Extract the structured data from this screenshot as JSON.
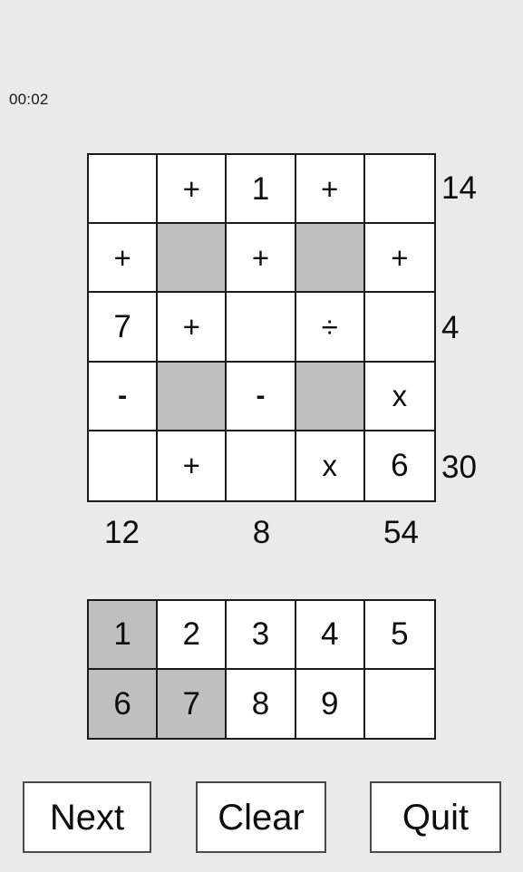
{
  "timer": {
    "label": "00:02"
  },
  "colors": {
    "background": "#eaeaea",
    "cell_background": "#ffffff",
    "blocked_cell": "#bfbfbf",
    "grid_line": "#1a1a1a",
    "text": "#0d0d0d",
    "button_border": "#4a4a4a"
  },
  "puzzle": {
    "rows": [
      [
        {
          "text": "",
          "blocked": false,
          "kind": "number-slot"
        },
        {
          "text": "+",
          "blocked": false,
          "kind": "operator"
        },
        {
          "text": "1",
          "blocked": false,
          "kind": "number"
        },
        {
          "text": "+",
          "blocked": false,
          "kind": "operator"
        },
        {
          "text": "",
          "blocked": false,
          "kind": "number-slot"
        }
      ],
      [
        {
          "text": "+",
          "blocked": false,
          "kind": "operator"
        },
        {
          "text": "",
          "blocked": true,
          "kind": "blocked"
        },
        {
          "text": "+",
          "blocked": false,
          "kind": "operator"
        },
        {
          "text": "",
          "blocked": true,
          "kind": "blocked"
        },
        {
          "text": "+",
          "blocked": false,
          "kind": "operator"
        }
      ],
      [
        {
          "text": "7",
          "blocked": false,
          "kind": "number"
        },
        {
          "text": "+",
          "blocked": false,
          "kind": "operator"
        },
        {
          "text": "",
          "blocked": false,
          "kind": "number-slot"
        },
        {
          "text": "÷",
          "blocked": false,
          "kind": "operator"
        },
        {
          "text": "",
          "blocked": false,
          "kind": "number-slot"
        }
      ],
      [
        {
          "text": "-",
          "blocked": false,
          "kind": "operator"
        },
        {
          "text": "",
          "blocked": true,
          "kind": "blocked"
        },
        {
          "text": "-",
          "blocked": false,
          "kind": "operator"
        },
        {
          "text": "",
          "blocked": true,
          "kind": "blocked"
        },
        {
          "text": "x",
          "blocked": false,
          "kind": "operator"
        }
      ],
      [
        {
          "text": "",
          "blocked": false,
          "kind": "number-slot"
        },
        {
          "text": "+",
          "blocked": false,
          "kind": "operator"
        },
        {
          "text": "",
          "blocked": false,
          "kind": "number-slot"
        },
        {
          "text": "x",
          "blocked": false,
          "kind": "operator"
        },
        {
          "text": "6",
          "blocked": false,
          "kind": "number"
        }
      ]
    ],
    "row_targets": [
      "14",
      "4",
      "30"
    ],
    "col_targets": [
      "12",
      "8",
      "54"
    ]
  },
  "tray": {
    "rows": [
      [
        {
          "text": "1",
          "used": true
        },
        {
          "text": "2",
          "used": false
        },
        {
          "text": "3",
          "used": false
        },
        {
          "text": "4",
          "used": false
        },
        {
          "text": "5",
          "used": false
        }
      ],
      [
        {
          "text": "6",
          "used": true
        },
        {
          "text": "7",
          "used": true
        },
        {
          "text": "8",
          "used": false
        },
        {
          "text": "9",
          "used": false
        },
        {
          "text": "",
          "used": false
        }
      ]
    ]
  },
  "buttons": {
    "next": "Next",
    "clear": "Clear",
    "quit": "Quit"
  }
}
